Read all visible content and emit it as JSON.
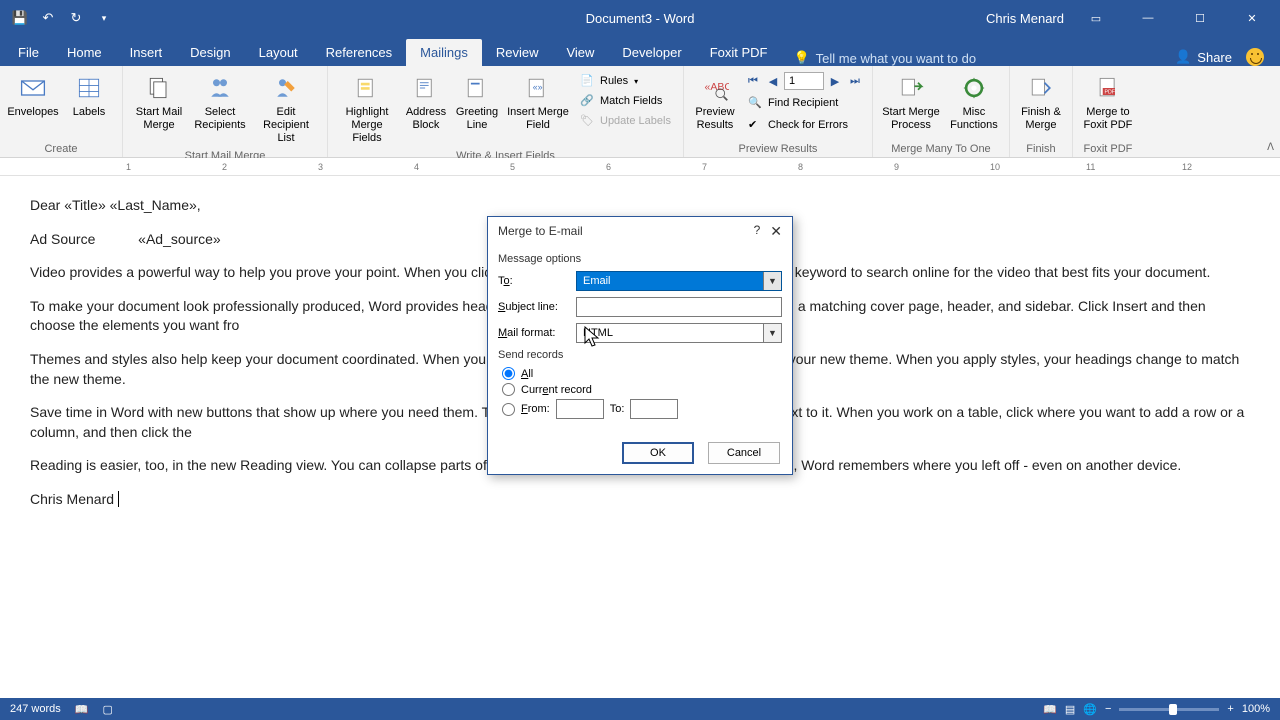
{
  "title": "Document3 - Word",
  "user": "Chris Menard",
  "tabs": [
    "File",
    "Home",
    "Insert",
    "Design",
    "Layout",
    "References",
    "Mailings",
    "Review",
    "View",
    "Developer",
    "Foxit PDF"
  ],
  "active_tab": 6,
  "tellme": "Tell me what you want to do",
  "share": "Share",
  "ribbon": {
    "create": {
      "label": "Create",
      "envelopes": "Envelopes",
      "labels": "Labels"
    },
    "smm": {
      "label": "Start Mail Merge",
      "start": "Start Mail\nMerge",
      "select": "Select\nRecipients",
      "edit": "Edit\nRecipient List"
    },
    "wif": {
      "label": "Write & Insert Fields",
      "highlight": "Highlight\nMerge Fields",
      "address": "Address\nBlock",
      "greeting": "Greeting\nLine",
      "insert": "Insert Merge\nField",
      "rules": "Rules",
      "match": "Match Fields",
      "update": "Update Labels"
    },
    "preview": {
      "label": "Preview Results",
      "btn": "Preview\nResults",
      "record": "1",
      "find": "Find Recipient",
      "check": "Check for Errors"
    },
    "mmto": {
      "label": "Merge Many To One",
      "start": "Start Merge\nProcess",
      "misc": "Misc\nFunctions"
    },
    "finish": {
      "label": "Finish",
      "btn": "Finish &\nMerge"
    },
    "foxit": {
      "label": "Foxit PDF",
      "btn": "Merge to\nFoxit PDF"
    }
  },
  "ruler_numbers": [
    "1",
    "2",
    "3",
    "4",
    "5",
    "6",
    "7",
    "8",
    "9",
    "10",
    "11",
    "12"
  ],
  "document": {
    "p1": "Dear «Title» «Last_Name»,",
    "p2a": "Ad Source",
    "p2b": "«Ad_source»",
    "p3": "Video provides a powerful way to help you prove your point. When you click                                                                the video you want to add. You can also type a keyword to search online for the video that best fits your document.",
    "p4": "To make your document look professionally produced, Word provides heade                                                              plement each other. For example, you can add a matching cover page, header, and sidebar. Click Insert and then choose the elements you want fro",
    "p5": "Themes and styles also help keep your document coordinated. When you cli                                                                  arts, and SmartArt graphics change to match your new theme. When you apply styles, your headings change to match the new theme.",
    "p6": "Save time in Word with new buttons that show up where you need them. To                                                                ck it and a button for layout options appears next to it. When you work on a table, click where you want to add a row or a column, and then click the",
    "p7": "Reading is easier, too, in the new Reading view. You can collapse parts of the                                                               eed to stop reading before you reach the end, Word remembers where you left off - even on another device.",
    "p8": "Chris Menard"
  },
  "dialog": {
    "title": "Merge to E-mail",
    "help": "?",
    "msg_options": "Message options",
    "to_label": "To:",
    "to_value": "Email",
    "subject_label": "Subject line:",
    "subject_value": "",
    "format_label": "Mail format:",
    "format_value": "HTML",
    "send_records": "Send records",
    "all": "All",
    "current": "Current record",
    "from": "From:",
    "to": "To:",
    "ok": "OK",
    "cancel": "Cancel"
  },
  "status": {
    "words": "247 words",
    "zoom": "100%"
  }
}
